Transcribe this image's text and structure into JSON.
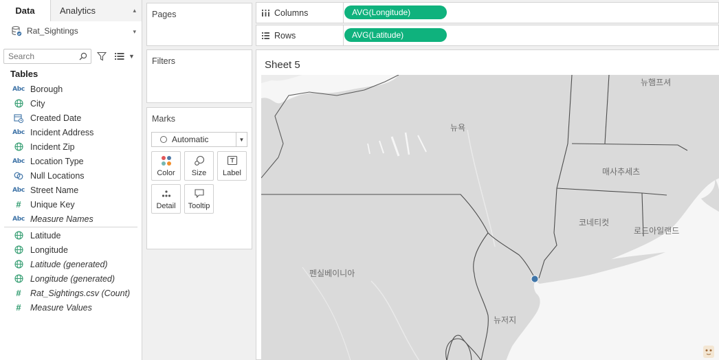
{
  "data_pane": {
    "tabs": [
      {
        "label": "Data"
      },
      {
        "label": "Analytics"
      }
    ],
    "data_source": "Rat_Sightings",
    "search": {
      "placeholder": "Search",
      "value": ""
    },
    "tables_header": "Tables",
    "dimensions": [
      {
        "label": "Borough",
        "type": "abc"
      },
      {
        "label": "City",
        "type": "geo"
      },
      {
        "label": "Created Date",
        "type": "date"
      },
      {
        "label": "Incident Address",
        "type": "abc"
      },
      {
        "label": "Incident Zip",
        "type": "geo"
      },
      {
        "label": "Location Type",
        "type": "abc"
      },
      {
        "label": "Null Locations",
        "type": "link"
      },
      {
        "label": "Street Name",
        "type": "abc"
      },
      {
        "label": "Unique Key",
        "type": "hash"
      },
      {
        "label": "Measure Names",
        "type": "abc",
        "italic": true
      }
    ],
    "measures": [
      {
        "label": "Latitude",
        "type": "geo"
      },
      {
        "label": "Longitude",
        "type": "geo"
      },
      {
        "label": "Latitude (generated)",
        "type": "geo",
        "italic": true
      },
      {
        "label": "Longitude (generated)",
        "type": "geo",
        "italic": true
      },
      {
        "label": "Rat_Sightings.csv (Count)",
        "type": "hash",
        "italic": true
      },
      {
        "label": "Measure Values",
        "type": "hash",
        "italic": true
      }
    ]
  },
  "cards": {
    "pages": "Pages",
    "filters": "Filters",
    "marks": "Marks",
    "mark_type": "Automatic",
    "mark_buttons": [
      "Color",
      "Size",
      "Label",
      "Detail",
      "Tooltip"
    ]
  },
  "shelves": {
    "columns": {
      "label": "Columns",
      "pill": "AVG(Longitude)"
    },
    "rows": {
      "label": "Rows",
      "pill": "AVG(Latitude)"
    }
  },
  "viz": {
    "sheet_title": "Sheet 5",
    "map_labels": {
      "new_york": "뉴욕",
      "new_hampshire": "뉴햄프셔",
      "massachusetts": "매사추세츠",
      "connecticut": "코네티컷",
      "rhode_island": "로드아일랜드",
      "pennsylvania": "펜실베이니아",
      "new_jersey": "뉴저지"
    }
  },
  "colors": {
    "pill": "#0fb27d",
    "mark": "#3f75a8",
    "map_land": "#dcdcdc",
    "map_water": "#f7f7f7",
    "border": "#4d4d4d"
  }
}
